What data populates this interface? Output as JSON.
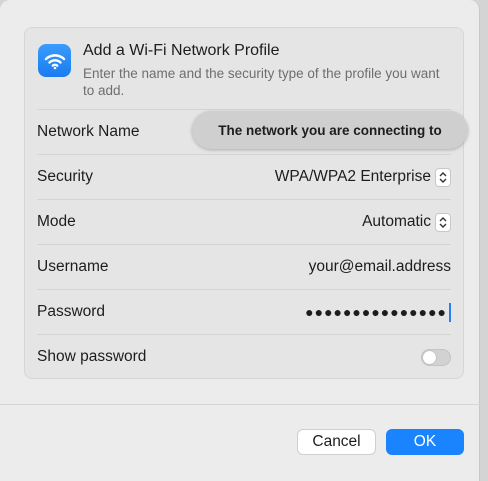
{
  "header": {
    "title": "Add a Wi-Fi Network Profile",
    "subtitle": "Enter the name and the security type of the profile you want to add.",
    "icon": "wifi-icon"
  },
  "fields": {
    "network_name": {
      "label": "Network Name",
      "tooltip": "The network you are connecting to"
    },
    "security": {
      "label": "Security",
      "value": "WPA/WPA2 Enterprise"
    },
    "mode": {
      "label": "Mode",
      "value": "Automatic"
    },
    "username": {
      "label": "Username",
      "value": "your@email.address"
    },
    "password": {
      "label": "Password",
      "value": "●●●●●●●●●●●●●●●"
    },
    "show_password": {
      "label": "Show password",
      "checked": false
    }
  },
  "buttons": {
    "cancel": "Cancel",
    "ok": "OK"
  },
  "colors": {
    "accent": "#1a84ff",
    "icon_bg": "#2a8cf7"
  }
}
